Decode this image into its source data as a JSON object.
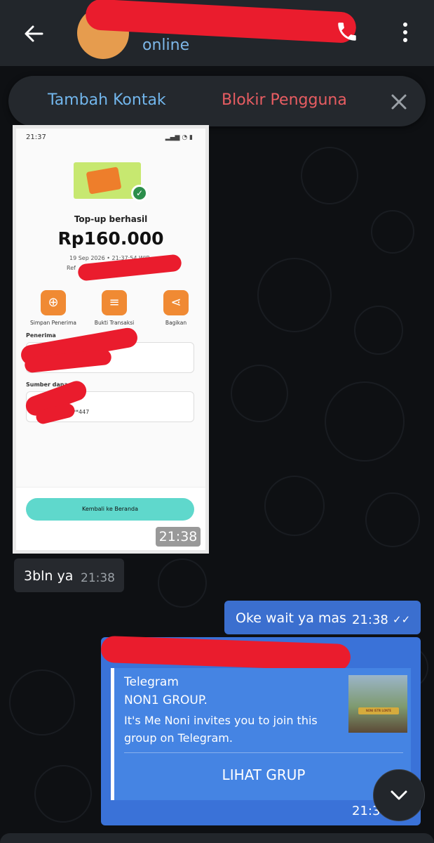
{
  "header": {
    "status": "online",
    "icons": [
      "back-arrow-icon",
      "phone-icon",
      "more-vert-icon"
    ]
  },
  "actionbar": {
    "add_contact": "Tambah Kontak",
    "block_user": "Blokir Pengguna"
  },
  "photo": {
    "status_time": "21:37",
    "title": "Top-up berhasil",
    "amount": "Rp160.000",
    "date": "19 Sep 2026 • 21:37:54 WIB",
    "ref_prefix": "Ref",
    "actions": [
      "Simpan Penerima",
      "Bukti Transaksi",
      "Bagikan"
    ],
    "recipient_label": "Penerima",
    "source_label": "Sumber dana",
    "source_masked": "***447",
    "back_button": "Kembali ke Beranda",
    "time": "21:38"
  },
  "messages": {
    "incoming": {
      "text": "3bln ya",
      "time": "21:38"
    },
    "outgoing": {
      "text": "Oke wait ya mas",
      "time": "21:38",
      "ticks": "✓✓"
    },
    "link": {
      "site": "Telegram",
      "title": "NON1 GROUP.",
      "description": "It's Me Noni invites you to join this group on Telegram.",
      "cta": "LIHAT GRUP",
      "time": "21:3",
      "thumb_text": "NONI ISTRI LONTE"
    }
  },
  "colors": {
    "topbar": "#22262b",
    "link_blue": "#72b6ec",
    "danger": "#e85d62",
    "outgoing_bubble": "#3b6fcf",
    "redaction": "#ea1c2d"
  }
}
